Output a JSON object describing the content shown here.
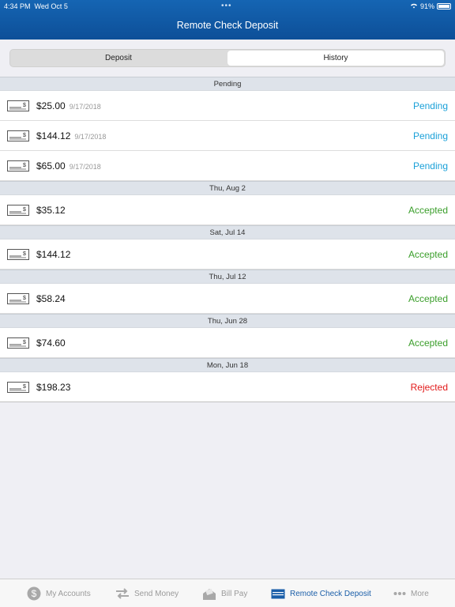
{
  "status_bar": {
    "time": "4:34 PM",
    "date": "Wed Oct 5",
    "battery": "91%"
  },
  "header": {
    "title": "Remote Check Deposit"
  },
  "segments": {
    "deposit": "Deposit",
    "history": "History"
  },
  "sections": [
    {
      "title": "Pending",
      "rows": [
        {
          "amount": "$25.00",
          "date": "9/17/2018",
          "status": "Pending"
        },
        {
          "amount": "$144.12",
          "date": "9/17/2018",
          "status": "Pending"
        },
        {
          "amount": "$65.00",
          "date": "9/17/2018",
          "status": "Pending"
        }
      ]
    },
    {
      "title": "Thu, Aug 2",
      "rows": [
        {
          "amount": "$35.12",
          "status": "Accepted"
        }
      ]
    },
    {
      "title": "Sat, Jul 14",
      "rows": [
        {
          "amount": "$144.12",
          "status": "Accepted"
        }
      ]
    },
    {
      "title": "Thu, Jul 12",
      "rows": [
        {
          "amount": "$58.24",
          "status": "Accepted"
        }
      ]
    },
    {
      "title": "Thu, Jun 28",
      "rows": [
        {
          "amount": "$74.60",
          "status": "Accepted"
        }
      ]
    },
    {
      "title": "Mon, Jun 18",
      "rows": [
        {
          "amount": "$198.23",
          "status": "Rejected"
        }
      ]
    }
  ],
  "tabbar": {
    "my_accounts": "My Accounts",
    "send_money": "Send Money",
    "bill_pay": "Bill Pay",
    "remote_check_deposit": "Remote Check Deposit",
    "more": "More"
  },
  "colors": {
    "header": "#1565b3",
    "pending": "#1aa0d8",
    "accepted": "#3a9e2a",
    "rejected": "#e21a1a",
    "active_tab": "#1a5ea8"
  }
}
